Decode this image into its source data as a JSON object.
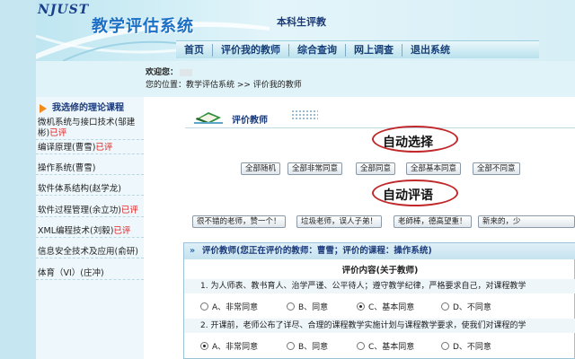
{
  "header": {
    "logo_en": "NJUST",
    "logo_cn": "教学评估系统",
    "subtitle": "本科生评教"
  },
  "nav": {
    "items": [
      "首页",
      "评价我的教师",
      "综合查询",
      "网上调查",
      "退出系统"
    ]
  },
  "welcome": {
    "label": "欢迎您：",
    "location": "您的位置：教学评估系统 >> 评价我的教师"
  },
  "sidebar": {
    "heading": "我选修的理论课程",
    "items": [
      {
        "text": "微机系统与接口技术(邹建",
        "tag": ""
      },
      {
        "text": "彬)",
        "tag": "已评"
      },
      {
        "text": "编译原理(曹雪)",
        "tag": "已评"
      },
      {
        "text": "操作系统(曹雪)",
        "tag": ""
      },
      {
        "text": "软件体系结构(赵学龙)",
        "tag": ""
      },
      {
        "text": "软件过程管理(余立功)",
        "tag": "已评"
      },
      {
        "text": "XML编程技术(刘毅)",
        "tag": "已评"
      },
      {
        "text": "信息安全技术及应用(俞研)",
        "tag": ""
      },
      {
        "text": "体育（VI）(庄冲)",
        "tag": ""
      }
    ]
  },
  "main": {
    "section_title": "评价教师",
    "annotation_auto_select": "自动选择",
    "annotation_auto_comment": "自动评语",
    "select_buttons": [
      "全部随机",
      "全部非常同意",
      "全部同意",
      "全部基本同意",
      "全部不同意"
    ],
    "comment_buttons": [
      "很不错的老师，赞一个！",
      "垃圾老师，误人子弟！",
      "老師棒，德高望重！",
      "新来的，少"
    ],
    "panel": {
      "title": "评价教师(您正在评价的教师：曹雪；评价的课程：操作系统)",
      "column_heading": "评价内容(关于教师)",
      "questions": [
        {
          "text": "1. 为人师表、教书育人、治学严谨、公平待人；遵守教学纪律，严格要求自己，对课程教学",
          "options": [
            "A、非常同意",
            "B、同意",
            "C、基本同意",
            "D、不同意"
          ],
          "selected": 2
        },
        {
          "text": "2. 开课前，老师公布了详尽、合理的课程教学实施计划与课程教学要求，使我们对课程的学",
          "options": [
            "A、非常同意",
            "B、同意",
            "C、基本同意",
            "D、不同意"
          ],
          "selected": 0
        }
      ]
    }
  },
  "colors": {
    "accent_red": "#c0282a",
    "nav_text": "#163e77",
    "tag_red": "#e02020"
  }
}
